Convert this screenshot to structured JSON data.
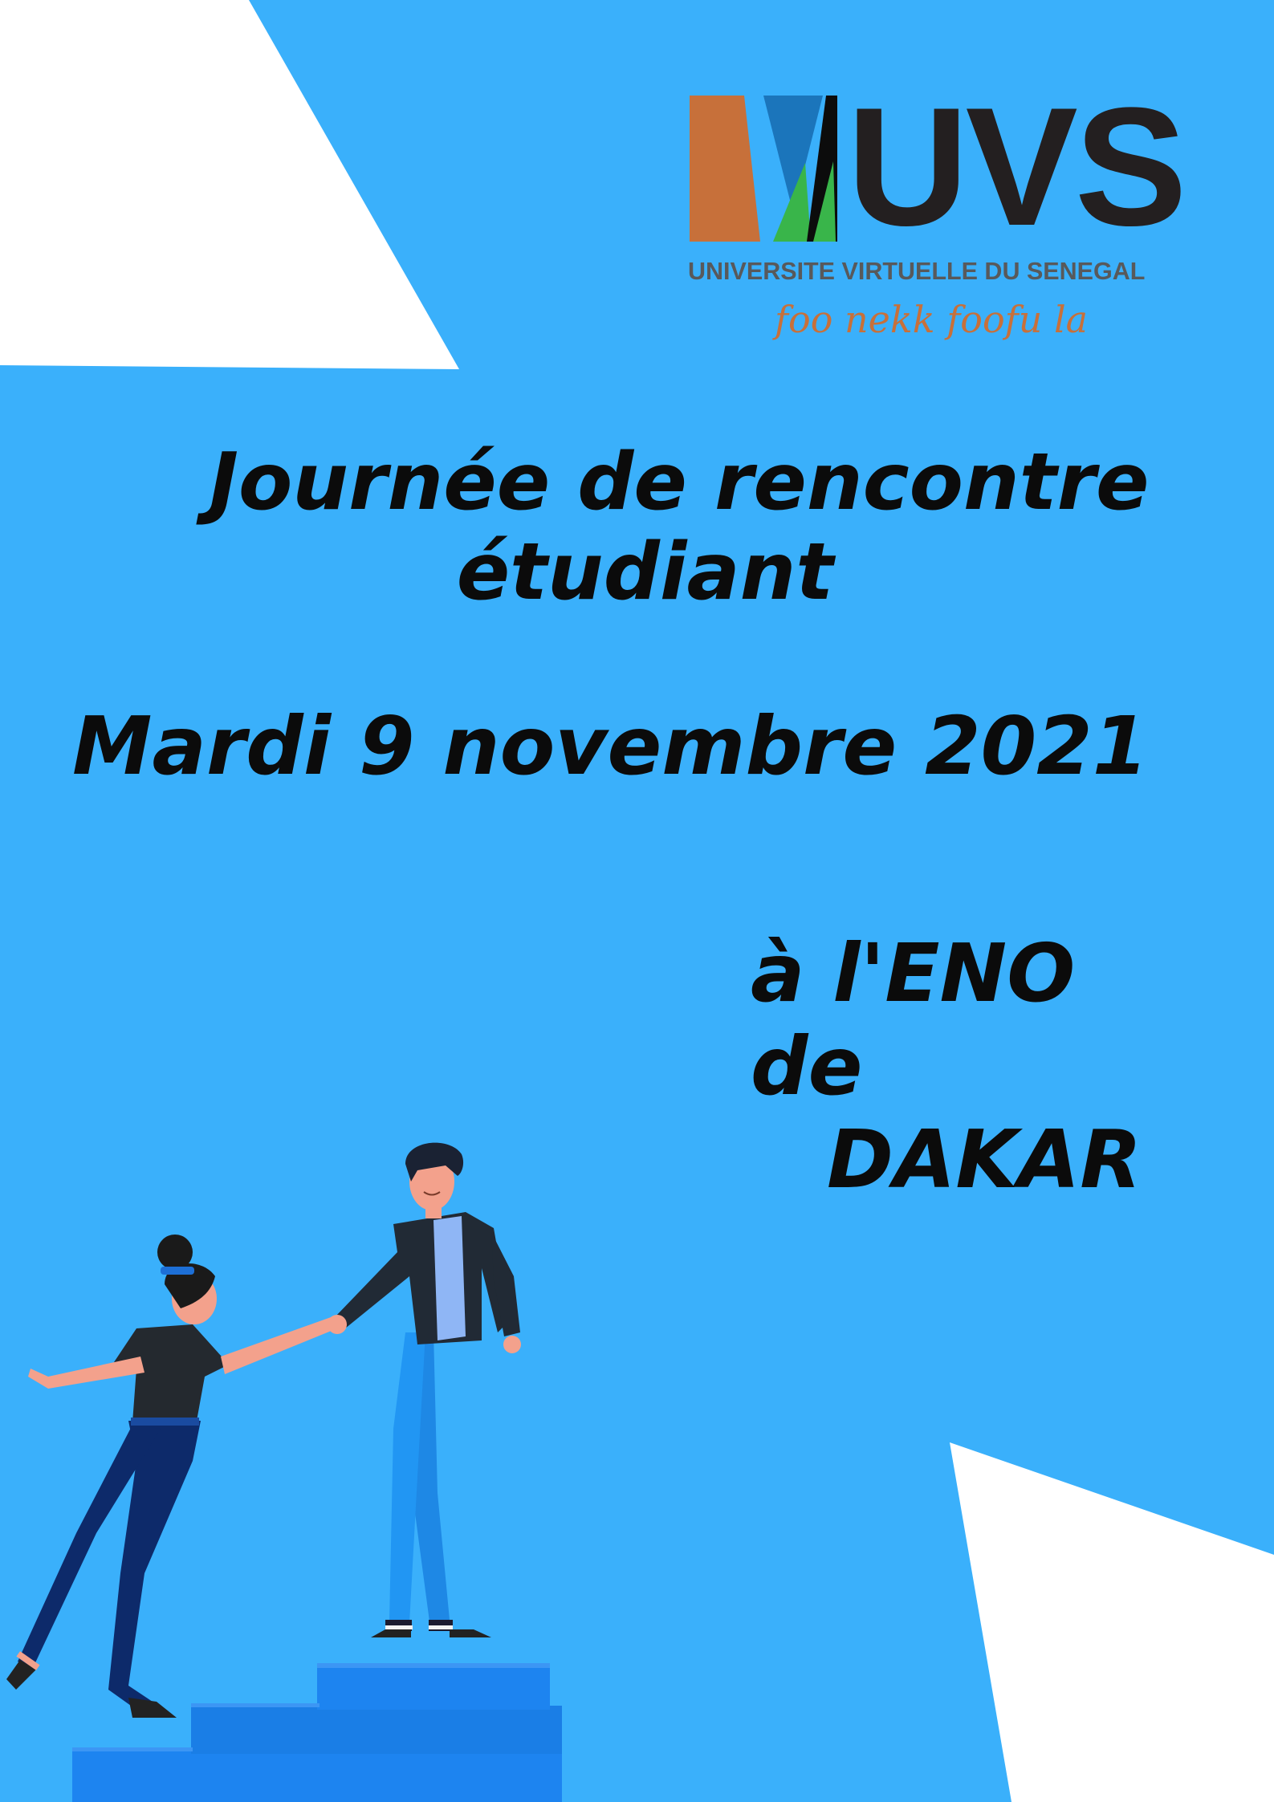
{
  "logo": {
    "wordmark": "UVS",
    "subtitle": "UNIVERSITE VIRTUELLE DU SENEGAL",
    "slogan": "foo nekk foofu la"
  },
  "event": {
    "title_line1": "Journée de rencontre",
    "title_line2": "étudiant",
    "date": "Mardi 9 novembre 2021",
    "venue_line1": "à l'ENO de",
    "venue_line2": "DAKAR"
  },
  "colors": {
    "background": "#3ab0fb",
    "white_shapes": "#ffffff",
    "logo_orange": "#c7703a",
    "logo_blue": "#1b75bb",
    "logo_green": "#39b54a",
    "text": "#0b0b0b",
    "stairs": "#1d84f0"
  },
  "icons": [
    "uvs-logo-icon",
    "handshake-illustration-icon",
    "stairs-icon"
  ]
}
